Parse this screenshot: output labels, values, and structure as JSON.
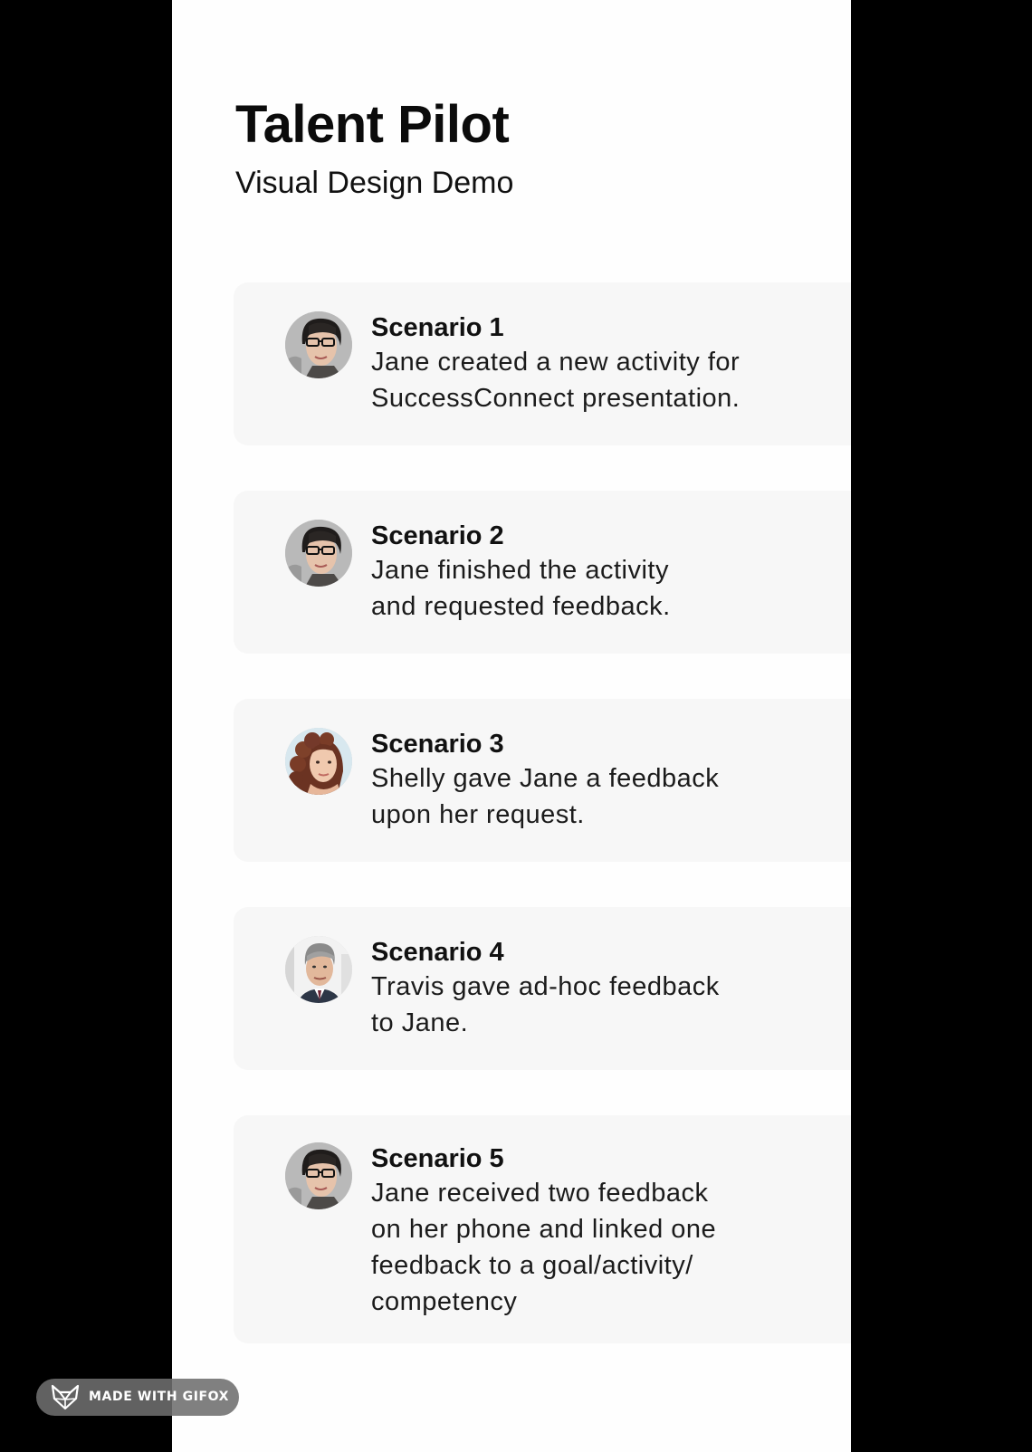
{
  "header": {
    "title": "Talent Pilot",
    "subtitle": "Visual Design Demo"
  },
  "scenarios": [
    {
      "title": "Scenario 1",
      "lines": [
        "Jane created a new activity for",
        "SuccessConnect presentation."
      ],
      "avatar_icon": "jane-avatar"
    },
    {
      "title": "Scenario 2",
      "lines": [
        "Jane finished the activity",
        "and requested feedback."
      ],
      "avatar_icon": "jane-avatar"
    },
    {
      "title": "Scenario 3",
      "lines": [
        "Shelly gave Jane a feedback",
        "upon her request."
      ],
      "avatar_icon": "shelly-avatar"
    },
    {
      "title": "Scenario 4",
      "lines": [
        "Travis gave ad-hoc feedback",
        "to Jane."
      ],
      "avatar_icon": "travis-avatar"
    },
    {
      "title": "Scenario 5",
      "lines": [
        "Jane received two feedback",
        "on her phone and linked one",
        "feedback to a goal/activity/",
        "competency"
      ],
      "avatar_icon": "jane-avatar"
    }
  ],
  "watermark": {
    "label": "MADE WITH GIFOX",
    "icon": "fox-icon"
  },
  "colors": {
    "background": "#000000",
    "page": "#fefefe",
    "card": "#f7f7f7",
    "text": "#111111"
  }
}
